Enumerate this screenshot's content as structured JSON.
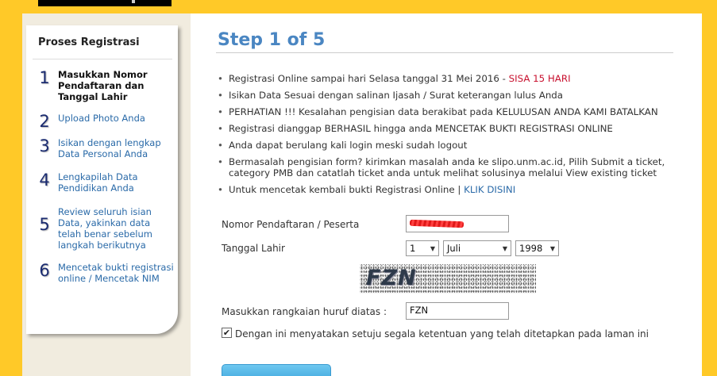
{
  "sidebar": {
    "title": "Proses Registrasi",
    "steps": [
      {
        "num": "1",
        "label": "Masukkan Nomor Pendaftaran dan Tanggal Lahir"
      },
      {
        "num": "2",
        "label": "Upload Photo Anda"
      },
      {
        "num": "3",
        "label": "Isikan dengan lengkap Data Personal Anda"
      },
      {
        "num": "4",
        "label": "Lengkapilah Data Pendidikan Anda"
      },
      {
        "num": "5",
        "label": "Review seluruh isian Data, yakinkan data telah benar sebelum langkah berikutnya"
      },
      {
        "num": "6",
        "label": "Mencetak bukti registrasi online / Mencetak NIM"
      }
    ]
  },
  "main": {
    "heading": "Step 1 of 5",
    "notices": {
      "n1_text": "Registrasi Online sampai hari Selasa tanggal 31 Mei 2016 - ",
      "n1_highlight": "SISA 15 HARI",
      "n2": "Isikan Data Sesuai dengan salinan Ijasah / Surat keterangan lulus Anda",
      "n3": "PERHATIAN !!! Kesalahan pengisian data berakibat pada KELULUSAN ANDA KAMI BATALKAN",
      "n4": "Registrasi dianggap BERHASIL hingga anda MENCETAK BUKTI REGISTRASI ONLINE",
      "n5": "Anda dapat berulang kali login meski sudah logout",
      "n6": "Bermasalah pengisian form? kirimkan masalah anda ke slipo.unm.ac.id, Pilih Submit a ticket, category PMB dan catatlah ticket anda untuk melihat solusinya melalui View existing ticket",
      "n7_text": "Untuk mencetak kembali bukti Registrasi Online | ",
      "n7_link": "KLIK DISINI"
    }
  },
  "form": {
    "nomor_label": "Nomor Pendaftaran / Peserta",
    "tanggal_label": "Tanggal Lahir",
    "day_value": "1",
    "month_value": "Juli",
    "year_value": "1998",
    "captcha_text": "FZN",
    "captcha_label": "Masukkan rangkaian huruf diatas :",
    "captcha_value": "FZN",
    "agree_checkmark": "✔",
    "agree_label": "Dengan ini menyatakan setuju segala ketentuan yang telah ditetapkan pada laman ini"
  }
}
